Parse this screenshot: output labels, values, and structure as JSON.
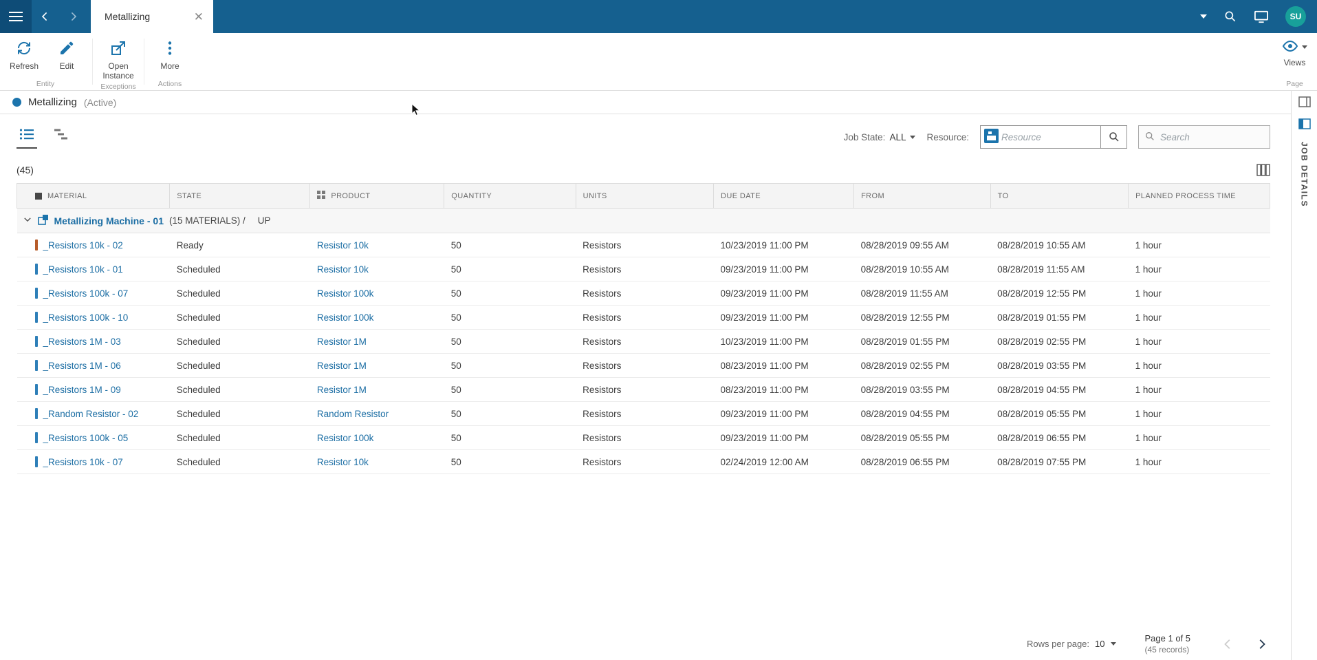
{
  "topbar": {
    "tab_title": "Metallizing",
    "avatar_initials": "SU"
  },
  "ribbon": {
    "refresh_label": "Refresh",
    "edit_label": "Edit",
    "open_instance_label": "Open\nInstance",
    "more_label": "More",
    "entity_group_label": "Entity",
    "exceptions_group_label": "Exceptions",
    "actions_group_label": "Actions",
    "views_label": "Views",
    "page_group_label": "Page"
  },
  "header": {
    "title": "Metallizing",
    "status": "(Active)"
  },
  "filters": {
    "job_state_label": "Job State:",
    "job_state_value": "ALL",
    "resource_label": "Resource:",
    "resource_placeholder": "Resource",
    "search_placeholder": "Search"
  },
  "table": {
    "count": "(45)",
    "columns": [
      "MATERIAL",
      "STATE",
      "PRODUCT",
      "QUANTITY",
      "UNITS",
      "DUE DATE",
      "FROM",
      "TO",
      "PLANNED PROCESS TIME"
    ],
    "group": {
      "name": "Metallizing Machine - 01",
      "materials_info": "(15 MATERIALS) /",
      "state": "UP"
    },
    "rows": [
      {
        "accent": "#b75c2a",
        "material": "_Resistors 10k - 02",
        "state": "Ready",
        "product": "Resistor 10k",
        "quantity": "50",
        "units": "Resistors",
        "due_date": "10/23/2019 11:00 PM",
        "from": "08/28/2019 09:55 AM",
        "to": "08/28/2019 10:55 AM",
        "planned_process_time": "1 hour"
      },
      {
        "accent": "#2e7fb8",
        "material": "_Resistors 10k - 01",
        "state": "Scheduled",
        "product": "Resistor 10k",
        "quantity": "50",
        "units": "Resistors",
        "due_date": "09/23/2019 11:00 PM",
        "from": "08/28/2019 10:55 AM",
        "to": "08/28/2019 11:55 AM",
        "planned_process_time": "1 hour"
      },
      {
        "accent": "#2e7fb8",
        "material": "_Resistors 100k - 07",
        "state": "Scheduled",
        "product": "Resistor 100k",
        "quantity": "50",
        "units": "Resistors",
        "due_date": "09/23/2019 11:00 PM",
        "from": "08/28/2019 11:55 AM",
        "to": "08/28/2019 12:55 PM",
        "planned_process_time": "1 hour"
      },
      {
        "accent": "#2e7fb8",
        "material": "_Resistors 100k - 10",
        "state": "Scheduled",
        "product": "Resistor 100k",
        "quantity": "50",
        "units": "Resistors",
        "due_date": "09/23/2019 11:00 PM",
        "from": "08/28/2019 12:55 PM",
        "to": "08/28/2019 01:55 PM",
        "planned_process_time": "1 hour"
      },
      {
        "accent": "#2e7fb8",
        "material": "_Resistors 1M - 03",
        "state": "Scheduled",
        "product": "Resistor 1M",
        "quantity": "50",
        "units": "Resistors",
        "due_date": "10/23/2019 11:00 PM",
        "from": "08/28/2019 01:55 PM",
        "to": "08/28/2019 02:55 PM",
        "planned_process_time": "1 hour"
      },
      {
        "accent": "#2e7fb8",
        "material": "_Resistors 1M - 06",
        "state": "Scheduled",
        "product": "Resistor 1M",
        "quantity": "50",
        "units": "Resistors",
        "due_date": "08/23/2019 11:00 PM",
        "from": "08/28/2019 02:55 PM",
        "to": "08/28/2019 03:55 PM",
        "planned_process_time": "1 hour"
      },
      {
        "accent": "#2e7fb8",
        "material": "_Resistors 1M - 09",
        "state": "Scheduled",
        "product": "Resistor 1M",
        "quantity": "50",
        "units": "Resistors",
        "due_date": "08/23/2019 11:00 PM",
        "from": "08/28/2019 03:55 PM",
        "to": "08/28/2019 04:55 PM",
        "planned_process_time": "1 hour"
      },
      {
        "accent": "#2e7fb8",
        "material": "_Random Resistor - 02",
        "state": "Scheduled",
        "product": "Random Resistor",
        "quantity": "50",
        "units": "Resistors",
        "due_date": "09/23/2019 11:00 PM",
        "from": "08/28/2019 04:55 PM",
        "to": "08/28/2019 05:55 PM",
        "planned_process_time": "1 hour"
      },
      {
        "accent": "#2e7fb8",
        "material": "_Resistors 100k - 05",
        "state": "Scheduled",
        "product": "Resistor 100k",
        "quantity": "50",
        "units": "Resistors",
        "due_date": "09/23/2019 11:00 PM",
        "from": "08/28/2019 05:55 PM",
        "to": "08/28/2019 06:55 PM",
        "planned_process_time": "1 hour"
      },
      {
        "accent": "#2e7fb8",
        "material": "_Resistors 10k - 07",
        "state": "Scheduled",
        "product": "Resistor 10k",
        "quantity": "50",
        "units": "Resistors",
        "due_date": "02/24/2019 12:00 AM",
        "from": "08/28/2019 06:55 PM",
        "to": "08/28/2019 07:55 PM",
        "planned_process_time": "1 hour"
      }
    ]
  },
  "job_details_panel": {
    "title": "JOB DETAILS"
  },
  "pagination": {
    "rows_per_page_label": "Rows per page:",
    "rows_per_page_value": "10",
    "page_info": "Page 1 of 5",
    "records_info": "(45 records)"
  },
  "colors": {
    "topbar": "#15608f",
    "accent_blue": "#1c74ac",
    "link": "#1c6ea4",
    "ready_accent": "#b75c2a",
    "scheduled_accent": "#2e7fb8",
    "avatar_bg": "#18a09a"
  }
}
